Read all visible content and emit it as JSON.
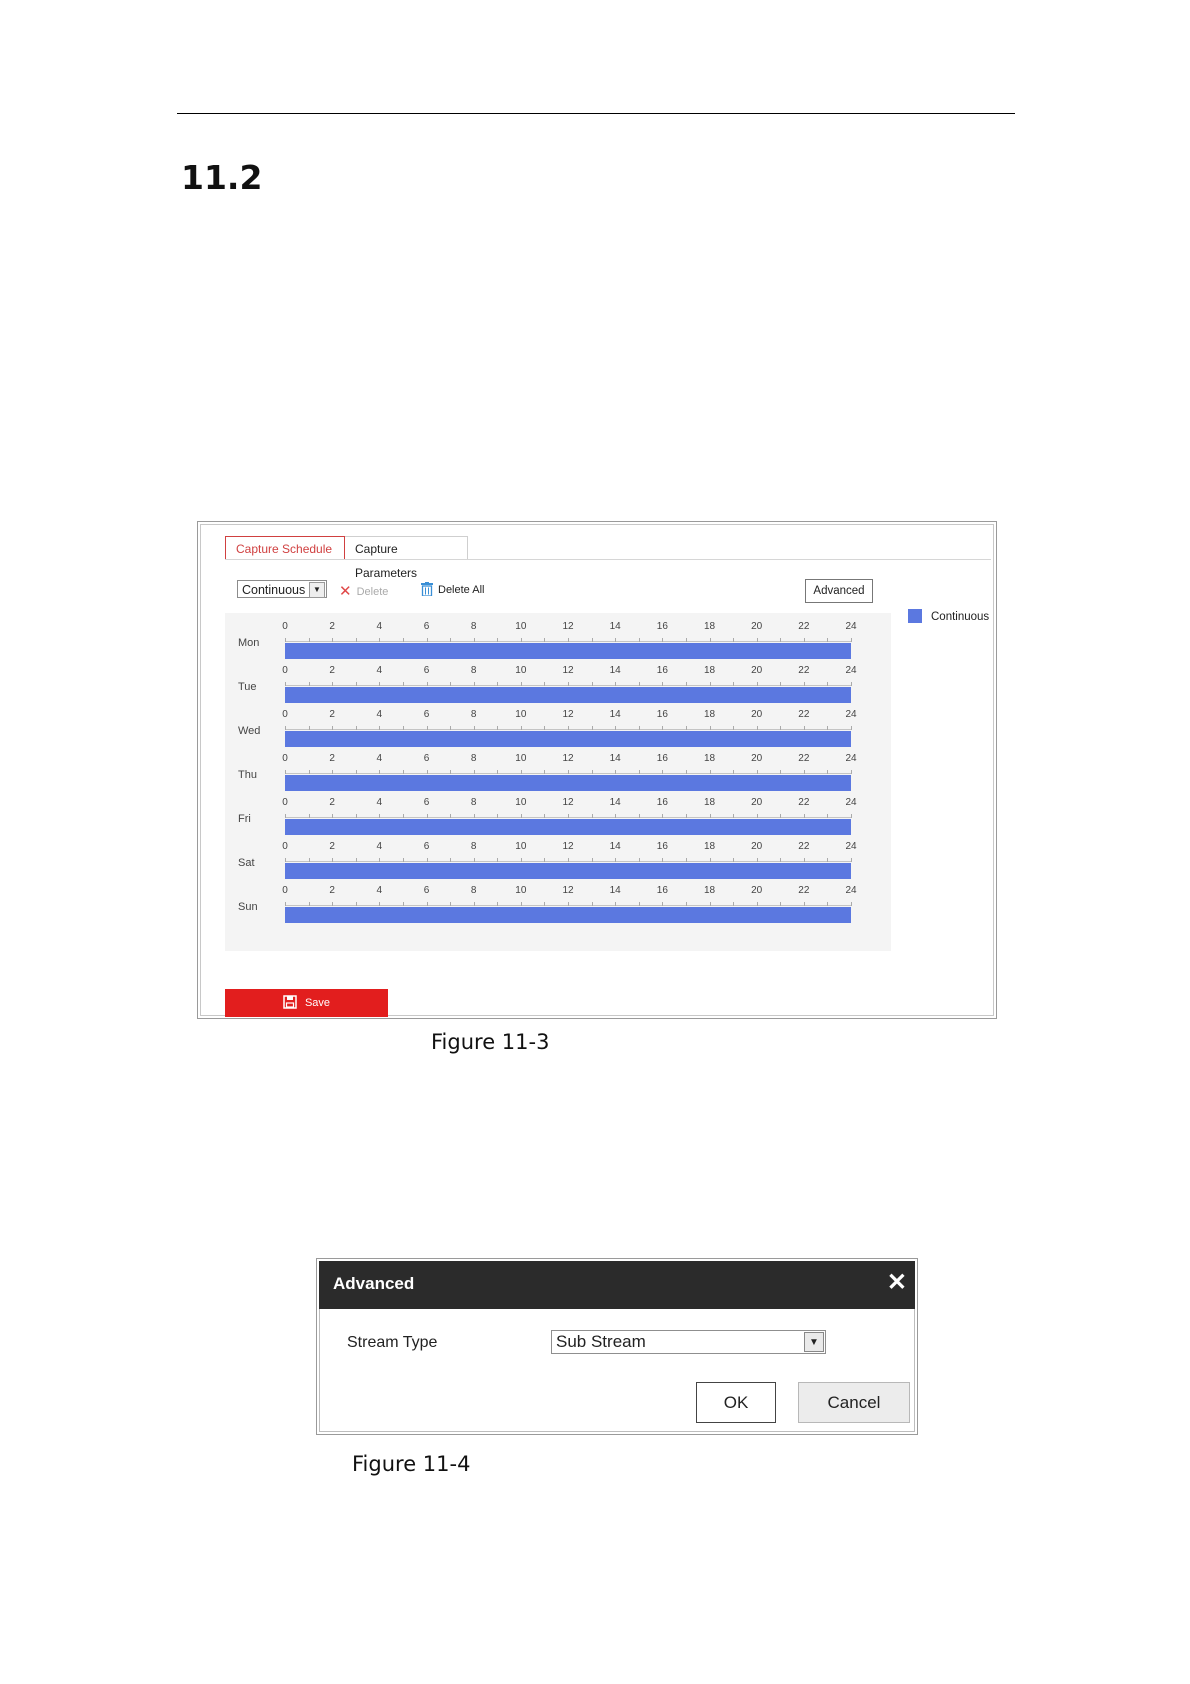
{
  "section_number": "11.2",
  "figure1": {
    "caption": "Figure 11-3",
    "tabs": [
      {
        "label": "Capture Schedule",
        "active": true
      },
      {
        "label": "Capture Parameters",
        "active": false
      }
    ],
    "mode_select": "Continuous",
    "delete_label": "Delete",
    "delete_all_label": "Delete All",
    "advanced_label": "Advanced",
    "legend_label": "Continuous",
    "save_label": "Save",
    "hour_labels": [
      "0",
      "2",
      "4",
      "6",
      "8",
      "10",
      "12",
      "14",
      "16",
      "18",
      "20",
      "22",
      "24"
    ],
    "days": [
      {
        "label": "Mon",
        "start": 0,
        "end": 24
      },
      {
        "label": "Tue",
        "start": 0,
        "end": 24
      },
      {
        "label": "Wed",
        "start": 0,
        "end": 24
      },
      {
        "label": "Thu",
        "start": 0,
        "end": 24
      },
      {
        "label": "Fri",
        "start": 0,
        "end": 24
      },
      {
        "label": "Sat",
        "start": 0,
        "end": 24
      },
      {
        "label": "Sun",
        "start": 0,
        "end": 24
      }
    ],
    "colors": {
      "continuous": "#5b78e0",
      "active_tab": "#d04040",
      "save": "#e21e1e"
    }
  },
  "figure2": {
    "caption": "Figure 11-4",
    "title": "Advanced",
    "stream_type_label": "Stream Type",
    "stream_type_value": "Sub Stream",
    "ok_label": "OK",
    "cancel_label": "Cancel"
  }
}
